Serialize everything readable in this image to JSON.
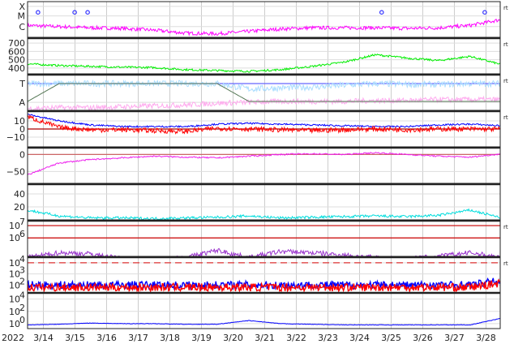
{
  "chart_data": {
    "type": "line",
    "year_label": "2022",
    "x_range_days": [
      13.5,
      28.45
    ],
    "x_ticks": [
      {
        "day": 14,
        "label": "3/14"
      },
      {
        "day": 15,
        "label": "3/15"
      },
      {
        "day": 16,
        "label": "3/16"
      },
      {
        "day": 17,
        "label": "3/17"
      },
      {
        "day": 18,
        "label": "3/18"
      },
      {
        "day": 19,
        "label": "3/19"
      },
      {
        "day": 20,
        "label": "3/20"
      },
      {
        "day": 21,
        "label": "3/21"
      },
      {
        "day": 22,
        "label": "3/22"
      },
      {
        "day": 23,
        "label": "3/23"
      },
      {
        "day": 24,
        "label": "3/24"
      },
      {
        "day": 25,
        "label": "3/25"
      },
      {
        "day": 26,
        "label": "3/26"
      },
      {
        "day": 27,
        "label": "3/27"
      },
      {
        "day": 28,
        "label": "3/28"
      }
    ],
    "key_days": [
      13.5,
      14.5,
      15.5,
      16.5,
      17.5,
      18.5,
      19.5,
      20.5,
      21.5,
      22.5,
      23.5,
      24.5,
      25.5,
      26.5,
      27.5,
      28.5
    ],
    "panels": [
      {
        "id": "xray",
        "ylim": [
          0,
          3
        ],
        "rt": "rt",
        "ticks": [
          {
            "v": 2.6,
            "label": "X"
          },
          {
            "v": 1.8,
            "label": "M"
          },
          {
            "v": 0.9,
            "label": "C"
          }
        ],
        "series": [
          {
            "name": "xray",
            "color": "#ff00ff",
            "values": [
              1.0,
              0.9,
              0.8,
              0.75,
              0.6,
              0.35,
              0.3,
              0.5,
              0.7,
              0.8,
              0.8,
              0.8,
              0.75,
              0.8,
              1.0,
              1.5
            ],
            "noise": 0.15
          }
        ],
        "flares": [
          13.83,
          14.99,
          15.4,
          24.7,
          27.96
        ],
        "flare_color": "#3333ff",
        "flare_level": 2.1
      },
      {
        "id": "speed",
        "ylim": [
          330,
          760
        ],
        "rt": "rt",
        "ticks": [
          {
            "v": 700,
            "label": "700"
          },
          {
            "v": 600,
            "label": "600"
          },
          {
            "v": 500,
            "label": "500"
          },
          {
            "v": 400,
            "label": "400"
          }
        ],
        "series": [
          {
            "name": "speed",
            "color": "#00ee00",
            "values": [
              450,
              430,
              420,
              410,
              405,
              380,
              370,
              360,
              380,
              420,
              470,
              560,
              520,
              490,
              540,
              440
            ],
            "noise": 12
          }
        ]
      },
      {
        "id": "imf",
        "ylim": [
          0,
          4
        ],
        "rt": "rt",
        "ticks": [
          {
            "v": 3,
            "label": "T"
          },
          {
            "v": 0.9,
            "label": "A"
          }
        ],
        "series": [
          {
            "name": "toward",
            "color": "#aaddff",
            "values": [
              3,
              3,
              3,
              3,
              3,
              3,
              3,
              2.4,
              2.5,
              2.6,
              2.8,
              3,
              2.9,
              2.9,
              3,
              3
            ],
            "noise": 0.35
          },
          {
            "name": "away",
            "color": "#ffaaee",
            "values": [
              0.2,
              0.3,
              0.3,
              0.4,
              0.5,
              0.6,
              0.8,
              0.9,
              1.0,
              1.0,
              1.0,
              1.1,
              1.1,
              1.2,
              1.2,
              1.2
            ],
            "noise": 0.3
          },
          {
            "name": "sector",
            "color": "#557755",
            "values": [
              1,
              3,
              3,
              3,
              3,
              3,
              3,
              1,
              1,
              1,
              1,
              1,
              1,
              1,
              1,
              1
            ],
            "noise": 0
          }
        ],
        "hline": {
          "v": 3,
          "color": "#6666ff"
        }
      },
      {
        "id": "bfield",
        "ylim": [
          -22,
          22
        ],
        "rt": "rt",
        "ticks": [
          {
            "v": 10,
            "label": "10"
          },
          {
            "v": 0,
            "label": "0"
          },
          {
            "v": -10,
            "label": "−10"
          }
        ],
        "series": [
          {
            "name": "Bt",
            "color": "#0000ff",
            "values": [
              18,
              10,
              5,
              3,
              3,
              3,
              6,
              7,
              6,
              5,
              4,
              3,
              3,
              5,
              6,
              4
            ],
            "noise": 1
          },
          {
            "name": "Bz",
            "color": "#ff0000",
            "values": [
              15,
              2,
              -1,
              -1,
              -2,
              -3,
              1,
              0,
              -1,
              -2,
              -1,
              0,
              -1,
              0,
              0,
              0
            ],
            "noise": 3
          }
        ],
        "hline": {
          "v": 0,
          "color": "#aa0000"
        }
      },
      {
        "id": "dst",
        "ylim": [
          -85,
          20
        ],
        "ticks": [
          {
            "v": 0,
            "label": "0"
          },
          {
            "v": -50,
            "label": "−50"
          }
        ],
        "series": [
          {
            "name": "Dst",
            "color": "#ee22ee",
            "values": [
              -60,
              -25,
              -15,
              -10,
              -5,
              -8,
              -10,
              -5,
              0,
              2,
              0,
              5,
              0,
              -5,
              -8,
              2
            ],
            "noise": 2
          }
        ],
        "hline": {
          "v": 0,
          "color": "#cc6666"
        }
      },
      {
        "id": "density",
        "ylim": [
          0,
          55
        ],
        "ticks": [
          {
            "v": 40,
            "label": "40"
          },
          {
            "v": 20,
            "label": "20"
          }
        ],
        "series": [
          {
            "name": "density",
            "color": "#00dddd",
            "values": [
              15,
              6,
              3,
              3,
              2,
              3,
              4,
              6,
              3,
              4,
              5,
              6,
              5,
              7,
              15,
              3
            ],
            "noise": 2
          }
        ]
      },
      {
        "id": "electrons",
        "ylim": [
          4.5,
          7.4
        ],
        "log": true,
        "rt": "rt",
        "ticks": [
          {
            "v": 7,
            "label": "10",
            "exp": "7"
          },
          {
            "v": 6,
            "label": "10",
            "exp": "6"
          }
        ],
        "series": [
          {
            "name": "electrons",
            "color": "#9933cc",
            "values": [
              4.4,
              4.8,
              4.7,
              4.3,
              4.3,
              4.4,
              5,
              4.4,
              4.9,
              4.8,
              4.6,
              4.4,
              4.3,
              4.5,
              4.8,
              4.4
            ],
            "noise": 0.2
          }
        ],
        "hlines": [
          {
            "v": 7,
            "color": "#cc0000"
          },
          {
            "v": 6,
            "color": "#cc0000"
          }
        ]
      },
      {
        "id": "protons",
        "ylim": [
          1.3,
          4.5
        ],
        "log": true,
        "rt": "rt",
        "ticks": [
          {
            "v": 4,
            "label": "10",
            "exp": "4"
          },
          {
            "v": 3,
            "label": "10",
            "exp": "3"
          },
          {
            "v": 2,
            "label": "10",
            "exp": "2"
          }
        ],
        "series": [
          {
            "name": "p-blue",
            "color": "#0000ff",
            "values": [
              2,
              2,
              2,
              2,
              2,
              2,
              2,
              2,
              2,
              2,
              2,
              2,
              2,
              2,
              2,
              2.4
            ],
            "noise": 0.35
          },
          {
            "name": "p-red",
            "color": "#ff0000",
            "values": [
              1.8,
              1.8,
              1.8,
              1.8,
              1.8,
              1.8,
              1.8,
              1.8,
              1.8,
              1.8,
              1.8,
              1.8,
              1.8,
              1.8,
              1.8,
              2.2
            ],
            "noise": 0.35
          }
        ],
        "dashed": {
          "v": 4,
          "color": "#dd3333"
        }
      },
      {
        "id": "lower",
        "ylim": [
          -0.8,
          5
        ],
        "log": true,
        "ticks": [
          {
            "v": 4,
            "label": "10",
            "exp": "4"
          },
          {
            "v": 2,
            "label": "10",
            "exp": "2"
          },
          {
            "v": 0,
            "label": "10",
            "exp": "0"
          }
        ],
        "series": [
          {
            "name": "lower",
            "color": "#0000ff",
            "values": [
              -0.2,
              -0.1,
              0.1,
              0,
              0,
              -0.1,
              -0.1,
              0.5,
              0,
              -0.1,
              -0.2,
              -0.2,
              -0.2,
              -0.2,
              -0.2,
              0.9
            ],
            "noise": 0.04
          }
        ]
      }
    ]
  }
}
